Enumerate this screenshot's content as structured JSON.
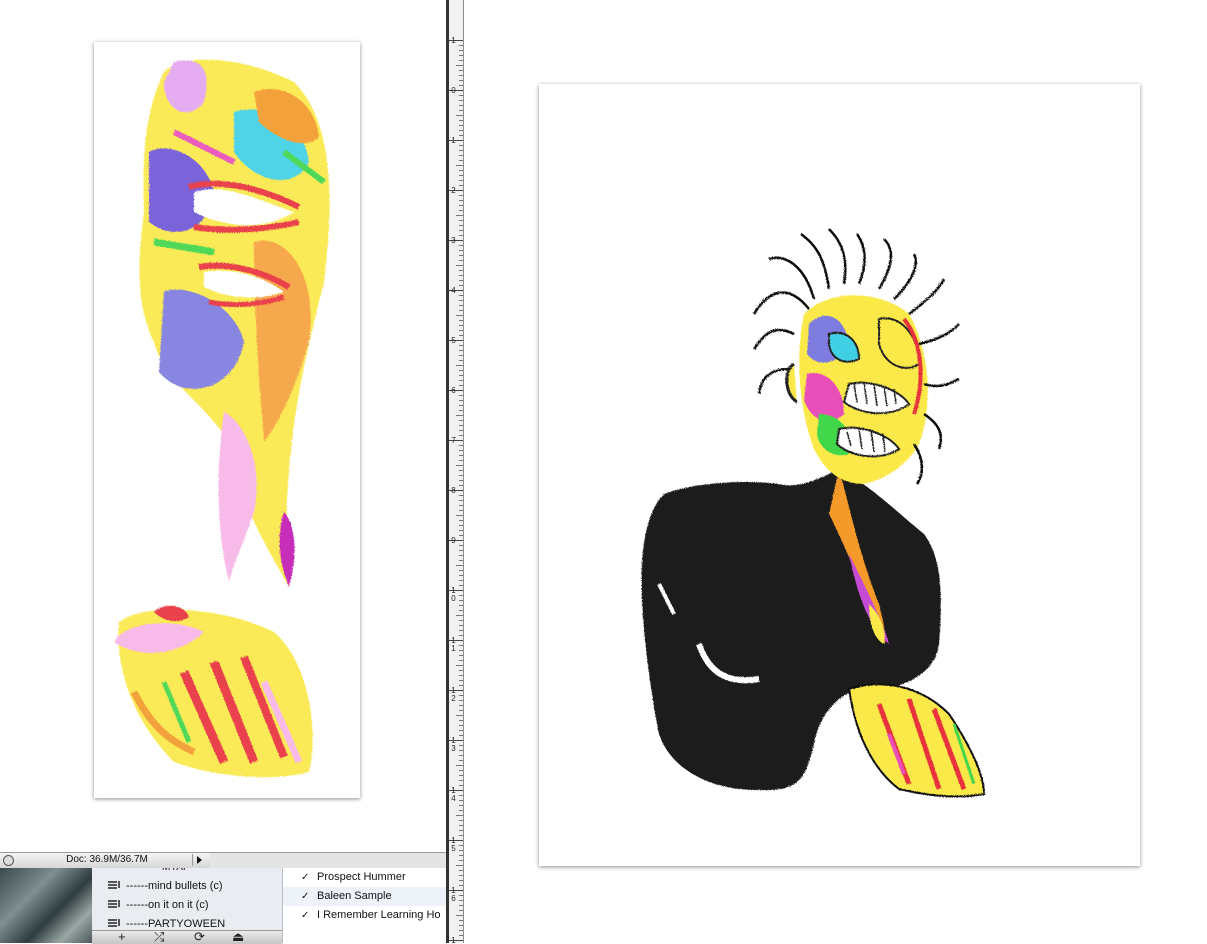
{
  "status_bar": {
    "doc_info": "Doc: 36.9M/36.7M"
  },
  "playlists": [
    {
      "label": "------mind bullets (c)"
    },
    {
      "label": "------on it on it (c)"
    },
    {
      "label": "------PARTYOWEEN"
    }
  ],
  "playlists_partial_top": "MYAI",
  "tracks": [
    {
      "checked": "✓",
      "title": "Prospect Hummer"
    },
    {
      "checked": "✓",
      "title": "Baleen Sample"
    },
    {
      "checked": "✓",
      "title": "I Remember Learning Ho"
    }
  ],
  "controls": {
    "add": "+",
    "shuffle": "⤮",
    "repeat": "⟳",
    "eject": "⏏"
  },
  "ruler_labels": [
    "1",
    "0",
    "1",
    "2",
    "3",
    "4",
    "5",
    "6",
    "7",
    "8",
    "9",
    "1\n0",
    "1\n1",
    "1\n2",
    "1\n3",
    "1\n4",
    "1\n5",
    "1\n6",
    "1\n7"
  ],
  "icons": {
    "status_zoom": "zoom-icon",
    "status_arrow": "chevron-right-icon",
    "playlist_item": "music-note-icon"
  },
  "colors": {
    "ruler_bg": "#f1f1f1",
    "playlist_bg": "#e9edf2",
    "divider": "#333333"
  }
}
